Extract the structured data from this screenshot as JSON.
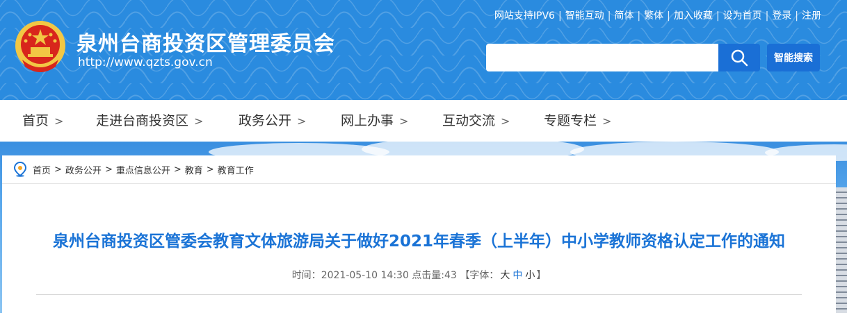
{
  "header": {
    "title": "泉州台商投资区管理委员会",
    "url": "http://www.qzts.gov.cn",
    "top_links": [
      "网站支持IPV6",
      "智能互动",
      "简体",
      "繁体",
      "加入收藏",
      "设为首页",
      "登录",
      "注册"
    ],
    "search": {
      "placeholder": "",
      "smart_search_label": "智能搜索"
    }
  },
  "nav": {
    "items": [
      "首页",
      "走进台商投资区",
      "政务公开",
      "网上办事",
      "互动交流",
      "专题专栏"
    ],
    "chevron": ">"
  },
  "breadcrumb": {
    "items": [
      "首页",
      "政务公开",
      "重点信息公开",
      "教育",
      "教育工作"
    ],
    "separator": ">"
  },
  "article": {
    "title": "泉州台商投资区管委会教育文体旅游局关于做好2021年春季（上半年）中小学教师资格认定工作的通知",
    "time_label": "时间：",
    "time": "2021-05-10 14:30",
    "hits_label": "点击量:",
    "hits": "43",
    "font_label_open": "【字体：",
    "font_large": "大",
    "font_medium": "中",
    "font_small": "小",
    "font_label_close": "】"
  },
  "colors": {
    "header_bg": "#2a8bdf",
    "accent": "#1a73d6",
    "button": "#1a6fd6"
  }
}
